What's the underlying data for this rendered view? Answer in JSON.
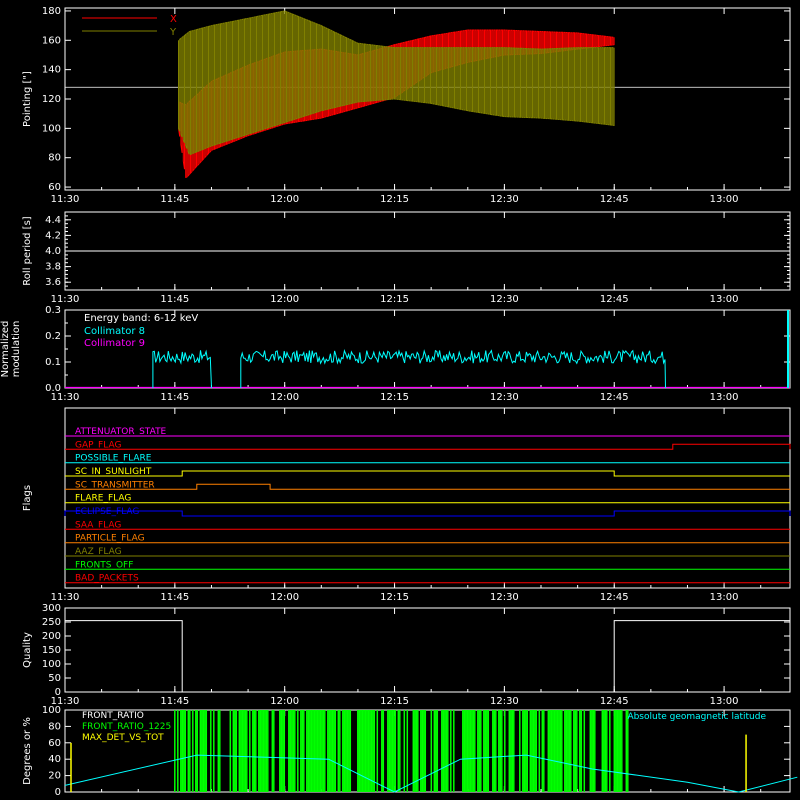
{
  "chart_data": [
    {
      "id": "pointing",
      "type": "line",
      "ylabel": "Pointing [\"]",
      "ylim": [
        58,
        182
      ],
      "yticks": [
        60,
        80,
        100,
        120,
        140,
        160,
        180
      ],
      "legend": [
        {
          "name": "X",
          "color": "#ff0000"
        },
        {
          "name": "Y",
          "color": "#808000"
        }
      ],
      "reference_level": 128,
      "series": [
        {
          "name": "X",
          "color": "#ff0000",
          "envelope": {
            "times": [
              "11:45:30",
              "11:46:30",
              "11:50",
              "11:55",
              "12:00",
              "12:05",
              "12:10",
              "12:15",
              "12:20",
              "12:25",
              "12:30",
              "12:35",
              "12:40",
              "12:45"
            ],
            "upper": [
              118,
              116,
              132,
              143,
              152,
              154,
              150,
              157,
              163,
              167,
              167,
              166,
              165,
              162
            ],
            "lower": [
              100,
              66,
              85,
              95,
              103,
              107,
              114,
              121,
              138,
              145,
              150,
              151,
              154,
              157
            ]
          }
        },
        {
          "name": "Y",
          "color": "#808000",
          "envelope": {
            "times": [
              "11:45:30",
              "11:47",
              "11:50",
              "11:55",
              "12:00",
              "12:05",
              "12:10",
              "12:15",
              "12:20",
              "12:25",
              "12:30",
              "12:35",
              "12:40",
              "12:45"
            ],
            "upper": [
              160,
              166,
              170,
              175,
              180,
              170,
              158,
              155,
              155,
              155,
              155,
              154,
              155,
              155
            ],
            "lower": [
              100,
              82,
              88,
              96,
              104,
              112,
              118,
              120,
              117,
              112,
              108,
              107,
              105,
              102
            ]
          }
        }
      ]
    },
    {
      "id": "roll_period",
      "type": "line",
      "ylabel": "Roll period [s]",
      "ylim": [
        3.5,
        4.5
      ],
      "yticks": [
        "3.6",
        "3.8",
        "4.0",
        "4.2",
        "4.4"
      ],
      "series": [
        {
          "name": "",
          "color": "#ffffff",
          "constant": 4.0
        }
      ]
    },
    {
      "id": "modulation",
      "type": "line",
      "ylabel": "Normalized modulation",
      "ylim": [
        0,
        0.3
      ],
      "yticks": [
        "0.0",
        "0.1",
        "0.2",
        "0.3"
      ],
      "annotation": "Energy band: 6-12 keV",
      "legend": [
        {
          "name": "Collimator 8",
          "color": "#00ffff"
        },
        {
          "name": "Collimator 9",
          "color": "#ff00ff"
        }
      ],
      "series": [
        {
          "name": "Collimator 8",
          "color": "#00ffff",
          "segments": [
            [
              "11:42",
              "11:50"
            ],
            [
              "11:54",
              "12:52"
            ]
          ],
          "typical": 0.12,
          "noise": 0.025
        },
        {
          "name": "Collimator 9",
          "color": "#ff00ff",
          "constant": 0.0
        }
      ]
    },
    {
      "id": "flags",
      "type": "line",
      "ylabel": "Flags",
      "flags": [
        {
          "name": "ATTENUATOR_STATE",
          "color": "#ff00ff",
          "events": []
        },
        {
          "name": "GAP_FLAG",
          "color": "#ff0000",
          "events": [
            [
              "12:53",
              "13:10",
              "high"
            ]
          ]
        },
        {
          "name": "POSSIBLE_FLARE",
          "color": "#00ffff",
          "events": []
        },
        {
          "name": "SC_IN_SUNLIGHT",
          "color": "#ffff00",
          "events": [
            [
              "11:46",
              "12:45",
              "high"
            ]
          ]
        },
        {
          "name": "SC_TRANSMITTER",
          "color": "#ff8000",
          "events": [
            [
              "11:48",
              "11:58",
              "high"
            ]
          ]
        },
        {
          "name": "FLARE_FLAG",
          "color": "#ffff00",
          "events": []
        },
        {
          "name": "ECLIPSE_FLAG",
          "color": "#0000ff",
          "events": [
            [
              "11:30",
              "11:46",
              "high"
            ],
            [
              "12:45",
              "13:10",
              "high"
            ]
          ]
        },
        {
          "name": "SAA_FLAG",
          "color": "#ff0000",
          "events": []
        },
        {
          "name": "PARTICLE_FLAG",
          "color": "#ff8000",
          "events": []
        },
        {
          "name": "AAZ_FLAG",
          "color": "#808000",
          "events": []
        },
        {
          "name": "FRONTS_OFF",
          "color": "#00ff00",
          "events": []
        },
        {
          "name": "BAD_PACKETS",
          "color": "#ff0000",
          "events": []
        }
      ]
    },
    {
      "id": "quality",
      "type": "line",
      "ylabel": "Quality",
      "ylim": [
        0,
        300
      ],
      "yticks": [
        "0",
        "50",
        "100",
        "150",
        "200",
        "250",
        "300"
      ],
      "series": [
        {
          "name": "",
          "color": "#ffffff",
          "steps": [
            [
              "11:30",
              "11:46",
              255
            ],
            [
              "11:46",
              "12:45",
              0
            ],
            [
              "12:45",
              "13:10",
              255
            ]
          ]
        }
      ]
    },
    {
      "id": "ratios",
      "type": "line",
      "ylabel": "Degrees or %",
      "ylim": [
        0,
        100
      ],
      "yticks": [
        "0",
        "20",
        "40",
        "60",
        "80",
        "100"
      ],
      "legend": [
        {
          "name": "FRONT_RATIO",
          "color": "#ffffff"
        },
        {
          "name": "FRONT_RATIO_1225",
          "color": "#00ff00"
        },
        {
          "name": "MAX_DET_VS_TOT",
          "color": "#ffff00"
        }
      ],
      "right_label": "Absolute geomagnetic latitude",
      "series": [
        {
          "name": "FRONT_RATIO_1225",
          "color": "#00ff00",
          "span": [
            "11:45",
            "12:47"
          ],
          "level": 100
        },
        {
          "name": "Absolute geomagnetic latitude",
          "color": "#00ffff",
          "x": [
            "11:30",
            "11:48",
            "12:06",
            "12:15",
            "12:24",
            "12:33",
            "12:42",
            "12:55",
            "13:02",
            "13:10"
          ],
          "y": [
            8,
            45,
            40,
            0,
            40,
            45,
            28,
            12,
            0,
            18
          ]
        }
      ]
    }
  ],
  "x_axis": {
    "range": [
      "11:30",
      "13:09"
    ],
    "ticks": [
      "11:30",
      "11:45",
      "12:00",
      "12:15",
      "12:30",
      "12:45",
      "13:00"
    ]
  }
}
